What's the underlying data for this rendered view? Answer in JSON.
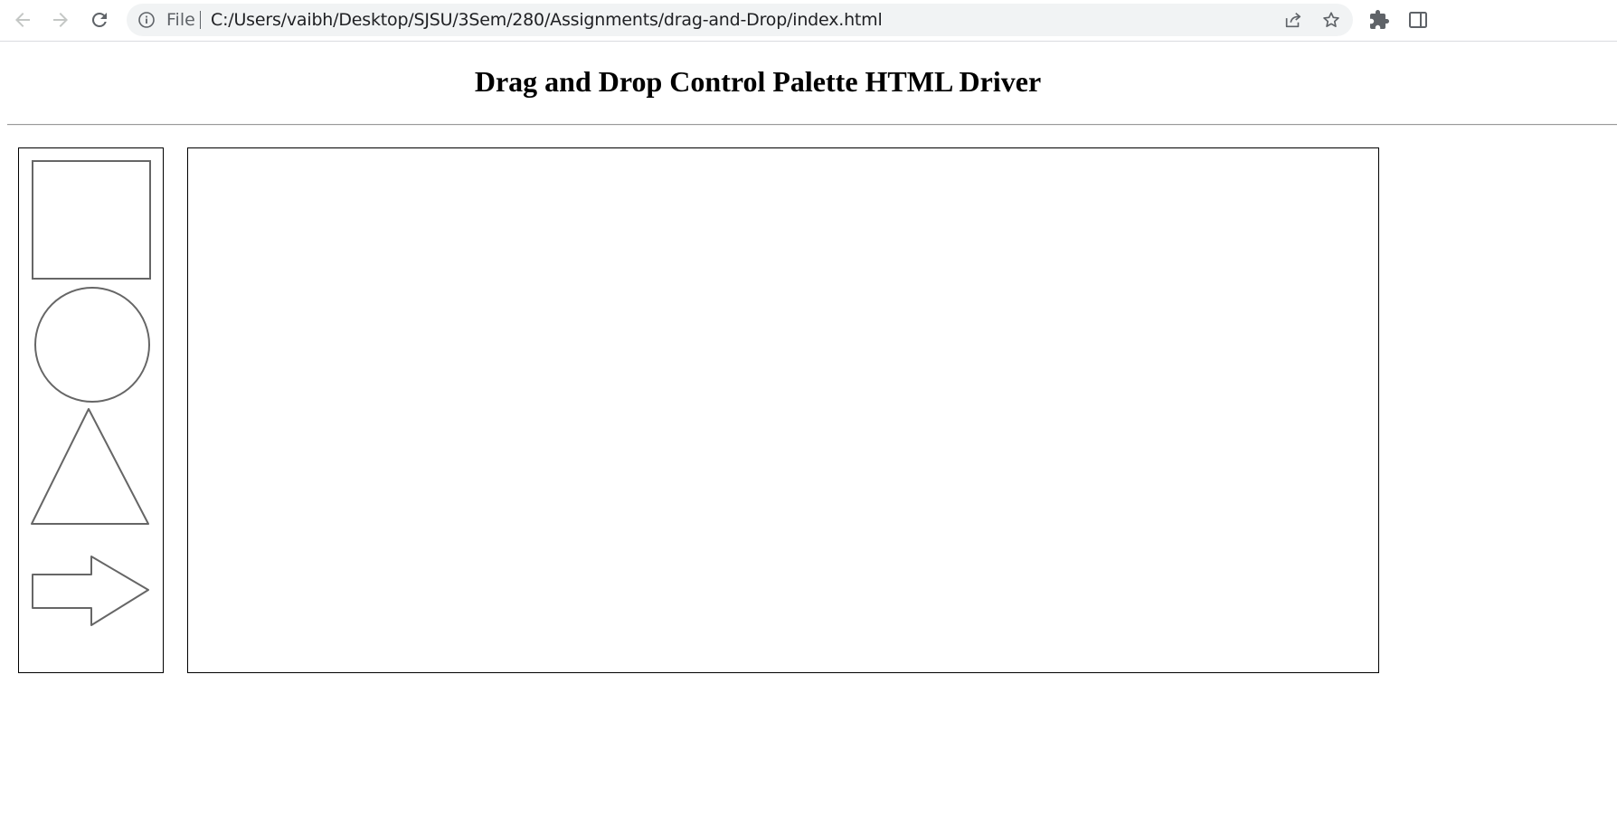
{
  "browser": {
    "site_info_label": "File",
    "url": "C:/Users/vaibh/Desktop/SJSU/3Sem/280/Assignments/drag-and-Drop/index.html",
    "icons": [
      "back-arrow-icon",
      "forward-arrow-icon",
      "reload-icon",
      "info-icon",
      "share-icon",
      "star-icon",
      "extensions-icon",
      "side-panel-icon"
    ]
  },
  "page": {
    "title": "Drag and Drop Control Palette HTML Driver"
  },
  "palette": {
    "shapes": [
      "square",
      "circle",
      "triangle",
      "arrow"
    ]
  },
  "colors": {
    "shape_stroke": "#666666",
    "border": "#000000",
    "chrome_icon": "#5f6368",
    "omnibox_bg": "#f1f3f4"
  }
}
